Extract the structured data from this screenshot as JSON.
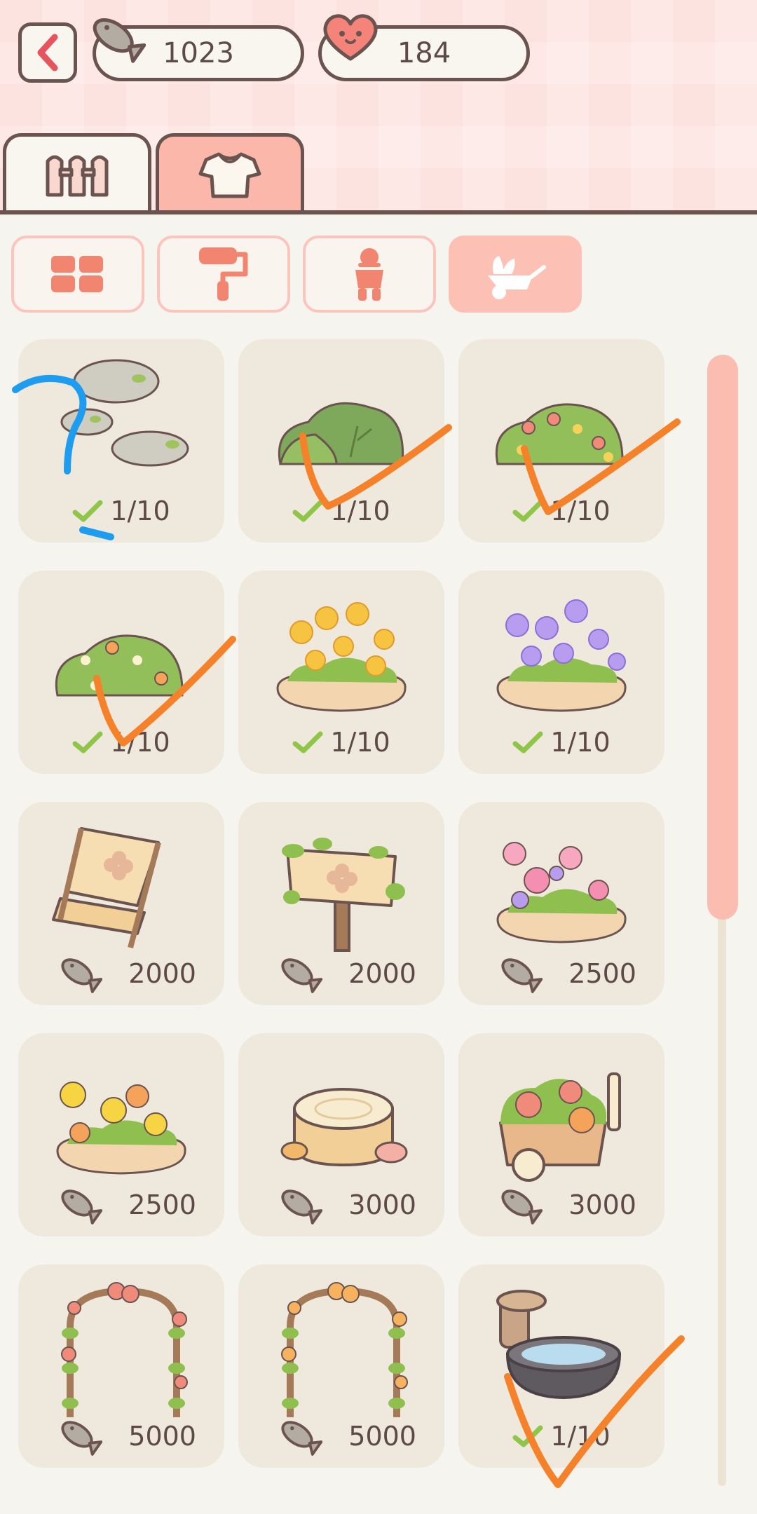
{
  "header": {
    "fish_count": "1023",
    "heart_count": "184"
  },
  "tabs": [
    {
      "name": "furniture",
      "icon": "fence-icon",
      "active": false
    },
    {
      "name": "clothes",
      "icon": "shirt-icon",
      "active": true
    }
  ],
  "categories": [
    {
      "icon": "floor-grid-icon",
      "active": false
    },
    {
      "icon": "paint-roller-icon",
      "active": false
    },
    {
      "icon": "figure-icon",
      "active": false
    },
    {
      "icon": "garden-wheelbarrow-icon",
      "active": true
    }
  ],
  "items": [
    {
      "name": "stepping-stones",
      "status": "1/10"
    },
    {
      "name": "green-bush",
      "status": "1/10"
    },
    {
      "name": "flowering-bush-red",
      "status": "1/10"
    },
    {
      "name": "flowering-bush-orange",
      "status": "1/10"
    },
    {
      "name": "yellow-flower-bed",
      "status": "1/10"
    },
    {
      "name": "purple-flower-bed",
      "status": "1/10"
    },
    {
      "name": "wooden-chair",
      "price": "2000"
    },
    {
      "name": "vine-signpost",
      "price": "2000"
    },
    {
      "name": "pink-flower-bed",
      "price": "2500"
    },
    {
      "name": "yellow-orange-flower-bed",
      "price": "2500"
    },
    {
      "name": "tree-stump",
      "price": "3000"
    },
    {
      "name": "flower-cart",
      "price": "3000"
    },
    {
      "name": "red-rose-arch",
      "price": "5000"
    },
    {
      "name": "orange-rose-arch",
      "price": "5000"
    },
    {
      "name": "stone-water-basin",
      "status": "1/10"
    }
  ],
  "colors": {
    "accent": "#fbb7aa",
    "outline": "#6b5450",
    "card": "#efe8dc",
    "check": "#8fc64a",
    "annotation_orange": "#f5822a",
    "annotation_blue": "#1e9cf0"
  }
}
